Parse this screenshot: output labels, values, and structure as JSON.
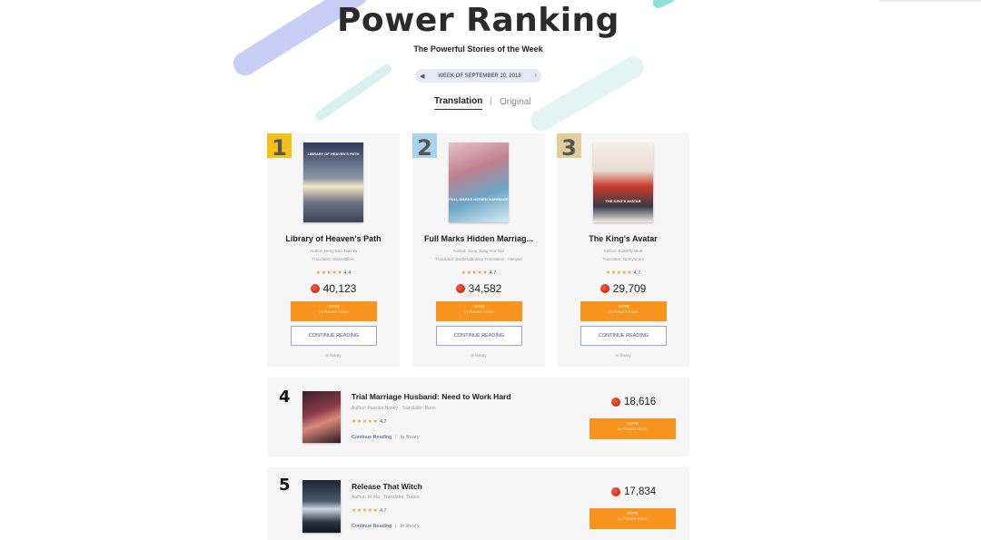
{
  "header": {
    "title": "Power Ranking",
    "subtitle": "The Powerful Stories of the Week",
    "week_label": "WEEK OF SEPTEMBER 10, 2018",
    "prev_icon": "caret-left-icon",
    "next_icon": "caret-right-icon"
  },
  "tabs": [
    {
      "label": "Translation",
      "active": true
    },
    {
      "label": "Original",
      "active": false
    }
  ],
  "top_books": [
    {
      "rank": "1",
      "badge_color": "#f5c018",
      "title": "Library of Heaven's Path",
      "cover_text": "LIBRARY OF HEAVEN'S PATH",
      "author_line": "Author: Heng Sao Tian Ya",
      "translator_line": "Translator: StarveCleric",
      "rating": "4.4",
      "votes": "40,123",
      "vote_label": "VOTE",
      "vote_sub": "IN POWER RANK",
      "continue_label": "CONTINUE READING",
      "library_label": "In library"
    },
    {
      "rank": "2",
      "badge_color": "#a9d2ec",
      "title": "Full Marks Hidden Marriag...",
      "cover_text": "FULL MARKS HIDDEN MARRIAGE",
      "author_line": "Author: Jiong Jiong You Yao",
      "translator_line": "Translator: Endlessfantasy Translation · Henyee",
      "rating": "4.7",
      "votes": "34,582",
      "vote_label": "VOTE",
      "vote_sub": "IN POWER RANK",
      "continue_label": "CONTINUE READING",
      "library_label": "In library"
    },
    {
      "rank": "3",
      "badge_color": "#e1cc9a",
      "title": "The King's Avatar",
      "cover_text": "THE KING'S AVATAR",
      "author_line": "Author: Butterfly Blue",
      "translator_line": "Translator: Nomyummi",
      "rating": "4.7",
      "votes": "29,709",
      "vote_label": "VOTE",
      "vote_sub": "IN POWER RANK",
      "continue_label": "CONTINUE READING",
      "library_label": "In library"
    }
  ],
  "list_books": [
    {
      "rank": "4",
      "title": "Trial Marriage Husband: Need to Work Hard",
      "meta_line": "Author: Passion Honey · Translator: Nuno",
      "rating": "4.7",
      "votes": "18,616",
      "continue_label": "Continue Reading",
      "library_label": "In library",
      "vote_label": "VOTE",
      "vote_sub": "IN POWER RANK"
    },
    {
      "rank": "5",
      "title": "Release That Witch",
      "meta_line": "Author: Er Mu · Translator: Tranto",
      "rating": "4.7",
      "votes": "17,834",
      "continue_label": "Continue Reading",
      "library_label": "In library",
      "vote_label": "VOTE",
      "vote_sub": "IN POWER RANK"
    }
  ],
  "stars_glyph": "★★★★★",
  "colors": {
    "accent_orange": "#f7941e",
    "card_bg": "#f6f6f6",
    "link_blue": "#3d4a8a"
  }
}
